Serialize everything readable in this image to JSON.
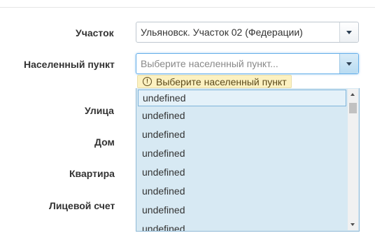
{
  "form": {
    "uchastok_label": "Участок",
    "uchastok_value": "Ульяновск. Участок 02 (Федерации)",
    "settlement_label": "Населенный пункт",
    "settlement_placeholder": "Выберите населенный пункт...",
    "settlement_hint": "Выберите населенный пункт",
    "street_label": "Улица",
    "house_label": "Дом",
    "apartment_label": "Квартира",
    "account_label": "Лицевой счет"
  },
  "dropdown": {
    "items": [
      "undefined",
      "undefined",
      "undefined",
      "undefined",
      "undefined",
      "undefined",
      "undefined",
      "undefined"
    ]
  },
  "icons": {
    "dropdown_arrow": "chevron-down-icon",
    "hint": "exclamation-circle-icon"
  },
  "colors": {
    "focus_border": "#66afe9",
    "dropdown_bg": "#d7e9f3",
    "hint_bg": "#fcf1c1"
  }
}
